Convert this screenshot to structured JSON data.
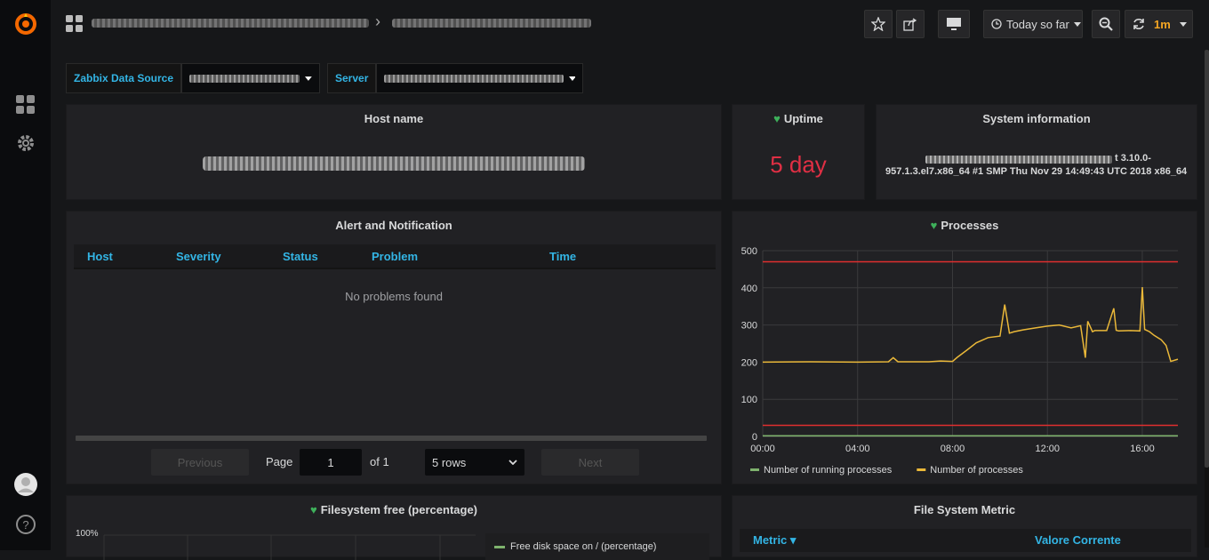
{
  "sidebar": {
    "items": [
      {
        "icon": "grafana-logo-icon"
      },
      {
        "icon": "dashboards-icon"
      },
      {
        "icon": "gear-icon"
      },
      {
        "icon": "avatar"
      },
      {
        "icon": "help-icon"
      }
    ]
  },
  "topbar": {
    "breadcrumb_separator": "›",
    "time_range": "Today so far",
    "refresh_interval": "1m"
  },
  "variables": [
    {
      "label": "Zabbix Data Source"
    },
    {
      "label": "Server"
    }
  ],
  "panels": {
    "host_name": {
      "title": "Host name"
    },
    "uptime": {
      "title": "Uptime",
      "value": "5 day"
    },
    "system_info": {
      "title": "System information",
      "line1_tail": "t 3.10.0-",
      "line2": "957.1.3.el7.x86_64 #1 SMP Thu Nov 29 14:49:43 UTC 2018 x86_64"
    },
    "alerts": {
      "title": "Alert and Notification",
      "columns": [
        "Host",
        "Severity",
        "Status",
        "Problem",
        "Time"
      ],
      "empty_text": "No problems found",
      "pagination": {
        "previous": "Previous",
        "page_label": "Page",
        "page": "1",
        "of_label": "of 1",
        "rows": "5 rows",
        "next": "Next"
      }
    },
    "processes": {
      "title": "Processes"
    },
    "filesystem": {
      "title": "Filesystem free (percentage)",
      "y_label": "100%",
      "legend": "Free disk space on / (percentage)"
    },
    "fs_metric": {
      "title": "File System Metric",
      "col1": "Metric ▾",
      "col2": "Valore Corrente"
    }
  },
  "chart_data": {
    "type": "line",
    "x_ticks": [
      "00:00",
      "04:00",
      "08:00",
      "12:00",
      "16:00"
    ],
    "y_ticks": [
      "0",
      "100",
      "200",
      "300",
      "400",
      "500"
    ],
    "ylim": [
      0,
      500
    ],
    "xlim_hours": [
      0,
      17.5
    ],
    "thresholds": [
      470,
      30
    ],
    "threshold_color": "#e02f2f",
    "series": [
      {
        "name": "Number of running processes",
        "color": "#7eb26d",
        "x": [
          0,
          17.5
        ],
        "values": [
          2,
          2
        ]
      },
      {
        "name": "Number of processes",
        "color": "#eab839",
        "x": [
          0,
          2,
          4,
          5.3,
          5.5,
          5.7,
          7,
          7.5,
          8,
          8.2,
          8.6,
          9,
          9.5,
          10,
          10.2,
          10.4,
          10.6,
          11,
          11.5,
          12,
          12.5,
          13,
          13.4,
          13.6,
          13.7,
          13.9,
          14,
          14.5,
          14.8,
          14.9,
          15,
          15.5,
          15.9,
          16,
          16.1,
          16.3,
          16.5,
          16.8,
          17,
          17.2,
          17.5
        ],
        "values": [
          200,
          201,
          200,
          201,
          212,
          201,
          201,
          203,
          202,
          213,
          232,
          252,
          266,
          270,
          355,
          278,
          282,
          287,
          292,
          297,
          300,
          292,
          298,
          212,
          310,
          282,
          285,
          285,
          345,
          286,
          284,
          285,
          284,
          402,
          288,
          282,
          272,
          260,
          245,
          202,
          208
        ]
      }
    ]
  },
  "legend": {
    "running": "Number of running processes",
    "total": "Number of processes"
  }
}
